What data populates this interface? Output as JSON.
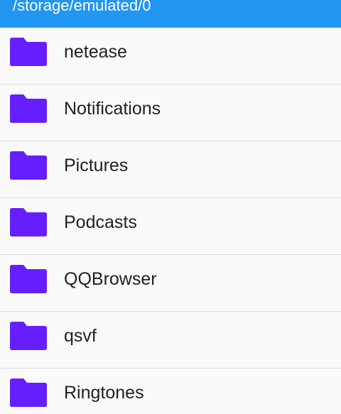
{
  "header": {
    "path": "/storage/emulated/0"
  },
  "colors": {
    "header_bg": "#2196f3",
    "folder": "#651fff",
    "text": "#212121",
    "divider": "#dedede"
  },
  "folders": [
    {
      "name": "netease",
      "icon": "folder-icon"
    },
    {
      "name": "Notifications",
      "icon": "folder-icon"
    },
    {
      "name": "Pictures",
      "icon": "folder-icon"
    },
    {
      "name": "Podcasts",
      "icon": "folder-icon"
    },
    {
      "name": "QQBrowser",
      "icon": "folder-icon"
    },
    {
      "name": "qsvf",
      "icon": "folder-icon"
    },
    {
      "name": "Ringtones",
      "icon": "folder-icon"
    }
  ]
}
